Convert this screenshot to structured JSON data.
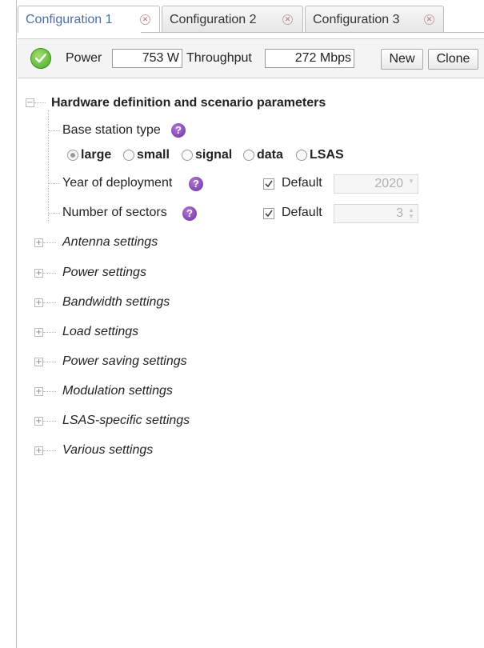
{
  "tabs": [
    {
      "label": "Configuration 1",
      "active": true
    },
    {
      "label": "Configuration 2",
      "active": false
    },
    {
      "label": "Configuration 3",
      "active": false
    }
  ],
  "toolbar": {
    "status_icon": "check-circle-icon",
    "power_label": "Power",
    "power_value": "753 W",
    "throughput_label": "Throughput",
    "throughput_value": "272 Mbps",
    "new_label": "New",
    "clone_label": "Clone"
  },
  "tree": {
    "root_label": "Hardware definition and scenario parameters",
    "base_station": {
      "label": "Base station type",
      "options": [
        "large",
        "small",
        "signal",
        "data",
        "LSAS"
      ],
      "selected": "large"
    },
    "year": {
      "label": "Year of deployment",
      "default_label": "Default",
      "default_checked": true,
      "value": "2020"
    },
    "sectors": {
      "label": "Number of sectors",
      "default_label": "Default",
      "default_checked": true,
      "value": "3"
    },
    "sections": [
      "Antenna settings",
      "Power settings",
      "Bandwidth settings",
      "Load settings",
      "Power saving settings",
      "Modulation settings",
      "LSAS-specific settings",
      "Various settings"
    ]
  },
  "colors": {
    "active_tab_text": "#4a6fa5",
    "status_green": "#4aa82b",
    "help_purple": "#6b2fa0"
  }
}
